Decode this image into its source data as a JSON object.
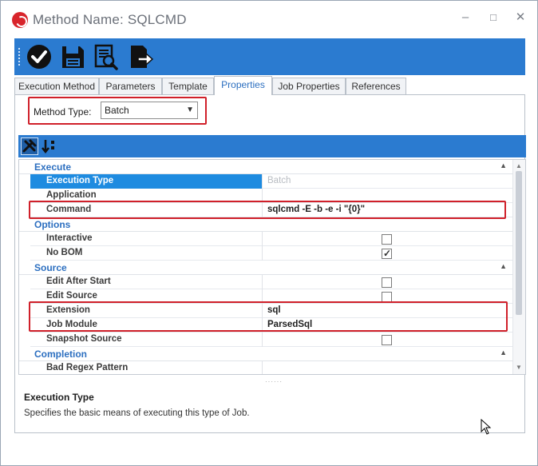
{
  "window": {
    "title": "Method Name: SQLCMD",
    "minimize_glyph": "–",
    "maximize_glyph": "□",
    "close_glyph": "✕"
  },
  "toolbar": {
    "buttons": [
      {
        "name": "ok-check-icon"
      },
      {
        "name": "save-icon"
      },
      {
        "name": "preview-icon"
      },
      {
        "name": "export-icon"
      }
    ]
  },
  "tabs": [
    {
      "label": "Execution Method"
    },
    {
      "label": "Parameters"
    },
    {
      "label": "Template"
    },
    {
      "label": "Properties",
      "active": true
    },
    {
      "label": "Job Properties"
    },
    {
      "label": "References"
    }
  ],
  "method_type": {
    "label": "Method Type:",
    "value": "Batch"
  },
  "property_grid": {
    "categories": [
      {
        "label": "Execute",
        "rows": [
          {
            "name": "Execution Type",
            "value": "Batch",
            "selected": true,
            "muted": true
          },
          {
            "name": "Application",
            "value": ""
          },
          {
            "name": "Command",
            "value": "sqlcmd -E -b -e -i \"{0}\""
          }
        ]
      },
      {
        "label": "Options",
        "rows": [
          {
            "name": "Interactive",
            "checkbox": false
          },
          {
            "name": "No BOM",
            "checkbox": true
          }
        ]
      },
      {
        "label": "Source",
        "rows": [
          {
            "name": "Edit After Start",
            "checkbox": false
          },
          {
            "name": "Edit Source",
            "checkbox": false
          },
          {
            "name": "Extension",
            "value": "sql"
          },
          {
            "name": "Job Module",
            "value": "ParsedSql"
          },
          {
            "name": "Snapshot Source",
            "checkbox": false
          }
        ]
      },
      {
        "label": "Completion",
        "rows": [
          {
            "name": "Bad Regex Pattern",
            "value": ""
          }
        ]
      }
    ]
  },
  "description": {
    "title": "Execution Type",
    "text": "Specifies the basic means of executing this type of Job."
  },
  "colors": {
    "accent": "#2b7bd0",
    "category_text": "#2c6fc0",
    "selection": "#1e8be0",
    "highlight_box": "#d0202a"
  }
}
